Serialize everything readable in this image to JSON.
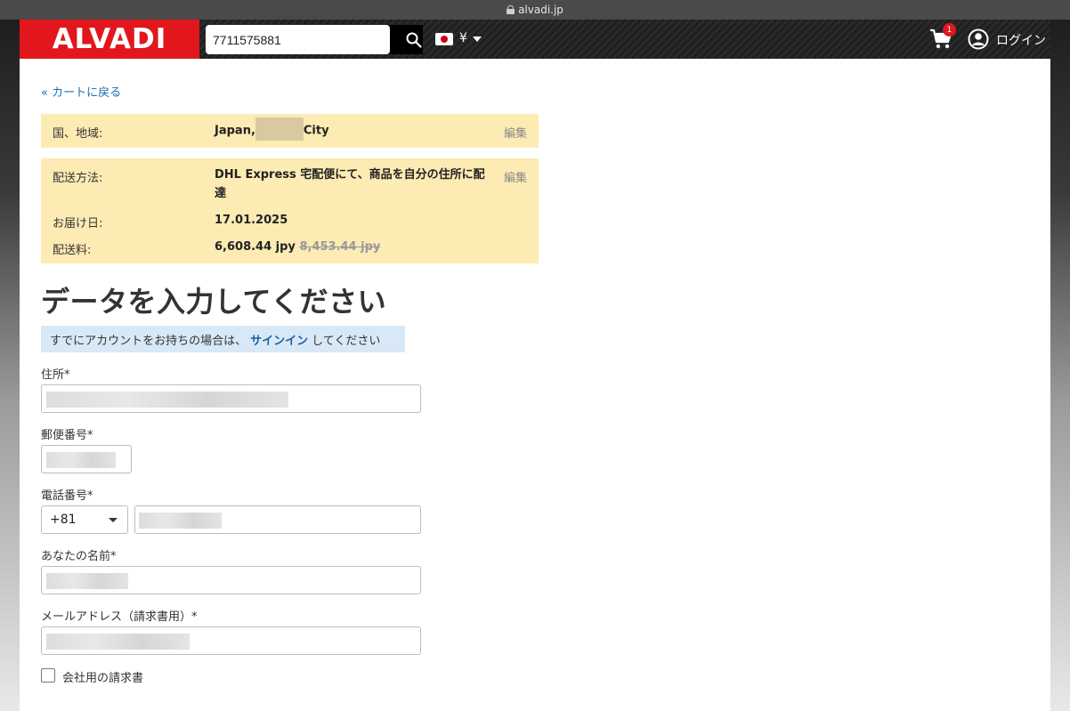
{
  "browser": {
    "url": "alvadi.jp"
  },
  "header": {
    "logo": "ALVADI",
    "search_value": "7711575881",
    "currency": "¥",
    "cart_count": "1",
    "login_label": "ログイン"
  },
  "nav": {
    "back_label": "« カートに戻る"
  },
  "region": {
    "label": "国、地域:",
    "value_prefix": "Japan,",
    "value_suffix": "City",
    "edit": "編集"
  },
  "shipping": {
    "method_label": "配送方法:",
    "method_value": "DHL Express 宅配便にて、商品を自分の住所に配達",
    "edit": "編集",
    "date_label": "お届け日:",
    "date_value": "17.01.2025",
    "fee_label": "配送料:",
    "fee_value": "6,608.44 jpy",
    "fee_old": "8,453.44 jpy"
  },
  "form": {
    "title": "データを入力してください",
    "signin_prefix": "すでにアカウントをお持ちの場合は、",
    "signin_link": "サインイン",
    "signin_suffix": "してください",
    "address_label": "住所*",
    "postal_label": "郵便番号*",
    "phone_label": "電話番号*",
    "country_code": "+81",
    "name_label": "あなたの名前*",
    "email_label": "メールアドレス（請求書用）*",
    "company_invoice_label": "会社用の請求書"
  },
  "colors": {
    "brand_red": "#e2171e",
    "panel_yellow": "#fdebb4",
    "note_blue": "#d8e8f7",
    "link_blue": "#1a6fb5"
  }
}
